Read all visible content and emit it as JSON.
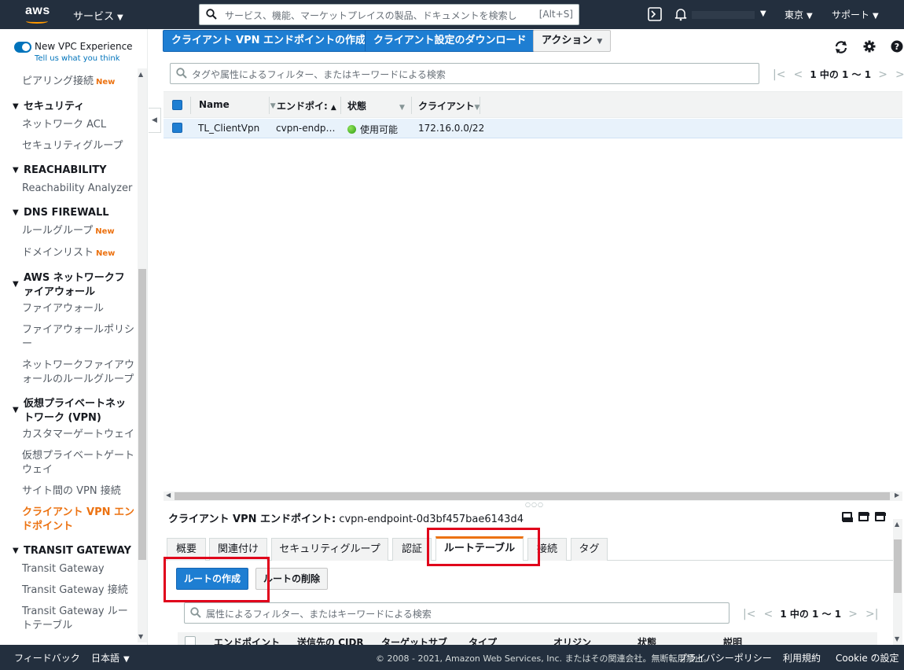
{
  "topnav": {
    "logo_text": "aws",
    "services": "サービス",
    "search_placeholder": "サービス、機能、マーケットプレイスの製品、ドキュメントを検索し",
    "search_shortcut": "[Alt+S]",
    "region": "東京",
    "support": "サポート"
  },
  "sidebar": {
    "new_vpc": "New VPC Experience",
    "tell_us": "Tell us what you think",
    "new_badge": "New",
    "items": {
      "peering": "ピアリング接続",
      "security": "セキュリティ",
      "nacl": "ネットワーク ACL",
      "sg": "セキュリティグループ",
      "reachability": "REACHABILITY",
      "reach_analyzer": "Reachability Analyzer",
      "dns_fw": "DNS FIREWALL",
      "rule_groups": "ルールグループ",
      "domain_list": "ドメインリスト",
      "nfw": "AWS ネットワークファイアウォール",
      "firewall": "ファイアウォール",
      "fw_policy": "ファイアウォールポリシー",
      "nfw_rule_groups": "ネットワークファイアウォールのルールグループ",
      "vpn": "仮想プライベートネットワーク (VPN)",
      "cgw": "カスタマーゲートウェイ",
      "vgw": "仮想プライベートゲートウェイ",
      "s2s": "サイト間の VPN 接続",
      "cvpn": "クライアント VPN エンドポイント",
      "tgw_head": "TRANSIT GATEWAY",
      "tgw": "Transit Gateway",
      "tgw_attach": "Transit Gateway 接続",
      "tgw_rt": "Transit Gateway ルートテーブル"
    }
  },
  "toolbar": {
    "create": "クライアント VPN エンドポイントの作成",
    "download": "クライアント設定のダウンロード",
    "actions": "アクション"
  },
  "filter": {
    "placeholder": "タグや属性によるフィルター、またはキーワードによる検索",
    "pager": "1 中の 1 〜 1"
  },
  "table": {
    "headers": [
      "Name",
      "エンドポイ:",
      "状態",
      "クライアント"
    ],
    "row": {
      "name": "TL_ClientVpn",
      "endpoint": "cvpn-endp…",
      "state": "使用可能",
      "cidr": "172.16.0.0/22"
    }
  },
  "detail": {
    "label": "クライアント VPN エンドポイント:",
    "id": "cvpn-endpoint-0d3bf457bae6143d4",
    "tabs": [
      "概要",
      "関連付け",
      "セキュリティグループ",
      "認証",
      "ルートテーブル",
      "接続",
      "タグ"
    ],
    "create_route": "ルートの作成",
    "delete_route": "ルートの削除",
    "filter_placeholder": "属性によるフィルター、またはキーワードによる検索",
    "pager": "1 中の 1 〜 1",
    "sub_headers": [
      "エンドポイント",
      "送信先の CIDR",
      "ターゲットサブ",
      "タイプ",
      "オリジン",
      "状態",
      "説明"
    ]
  },
  "footer": {
    "feedback": "フィードバック",
    "language": "日本語",
    "copyright": "© 2008 - 2021, Amazon Web Services, Inc. またはその関連会社。無断転用禁止。",
    "privacy": "プライバシーポリシー",
    "terms": "利用規約",
    "cookie": "Cookie の設定"
  },
  "colors": {
    "nav": "#232f3e",
    "primary": "#1e7ed2",
    "accent": "#ec7211",
    "highlight": "#e0001b"
  }
}
